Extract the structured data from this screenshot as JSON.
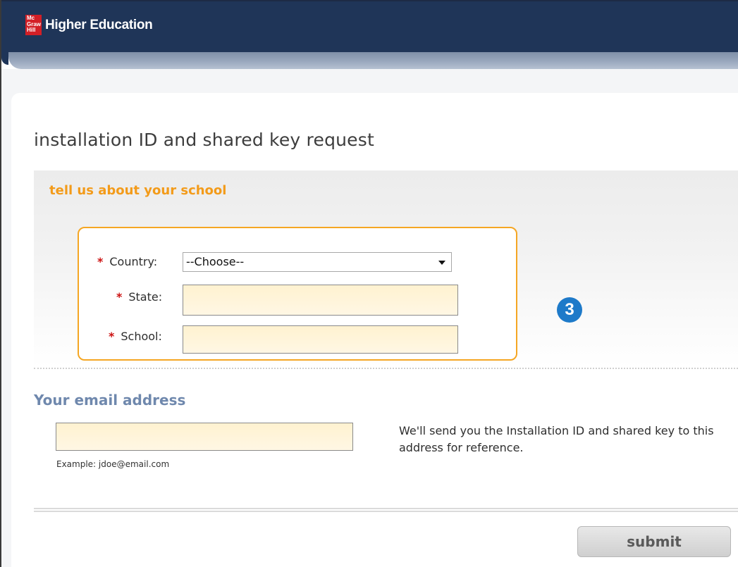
{
  "header": {
    "logo": {
      "line1": "Mc",
      "line2": "Graw",
      "line3": "Hill"
    },
    "brand": "Higher Education"
  },
  "page": {
    "title": "installation ID and shared key request"
  },
  "school_section": {
    "heading": "tell us about your school",
    "required_marker": "*",
    "country": {
      "label": "Country:",
      "selected": "--Choose--"
    },
    "state": {
      "label": "State:",
      "value": ""
    },
    "school": {
      "label": "School:",
      "value": ""
    },
    "step_badge": "3"
  },
  "email_section": {
    "heading": "Your email address",
    "value": "",
    "example": "Example: jdoe@email.com",
    "note": "We'll send you the Installation ID and shared key to this address for reference."
  },
  "actions": {
    "submit_label": "submit"
  },
  "colors": {
    "header_bg": "#1f3558",
    "section_heading": "#f39b1a",
    "email_heading": "#6f88ad",
    "required_star": "#cc1111",
    "badge": "#1e7ac9"
  }
}
